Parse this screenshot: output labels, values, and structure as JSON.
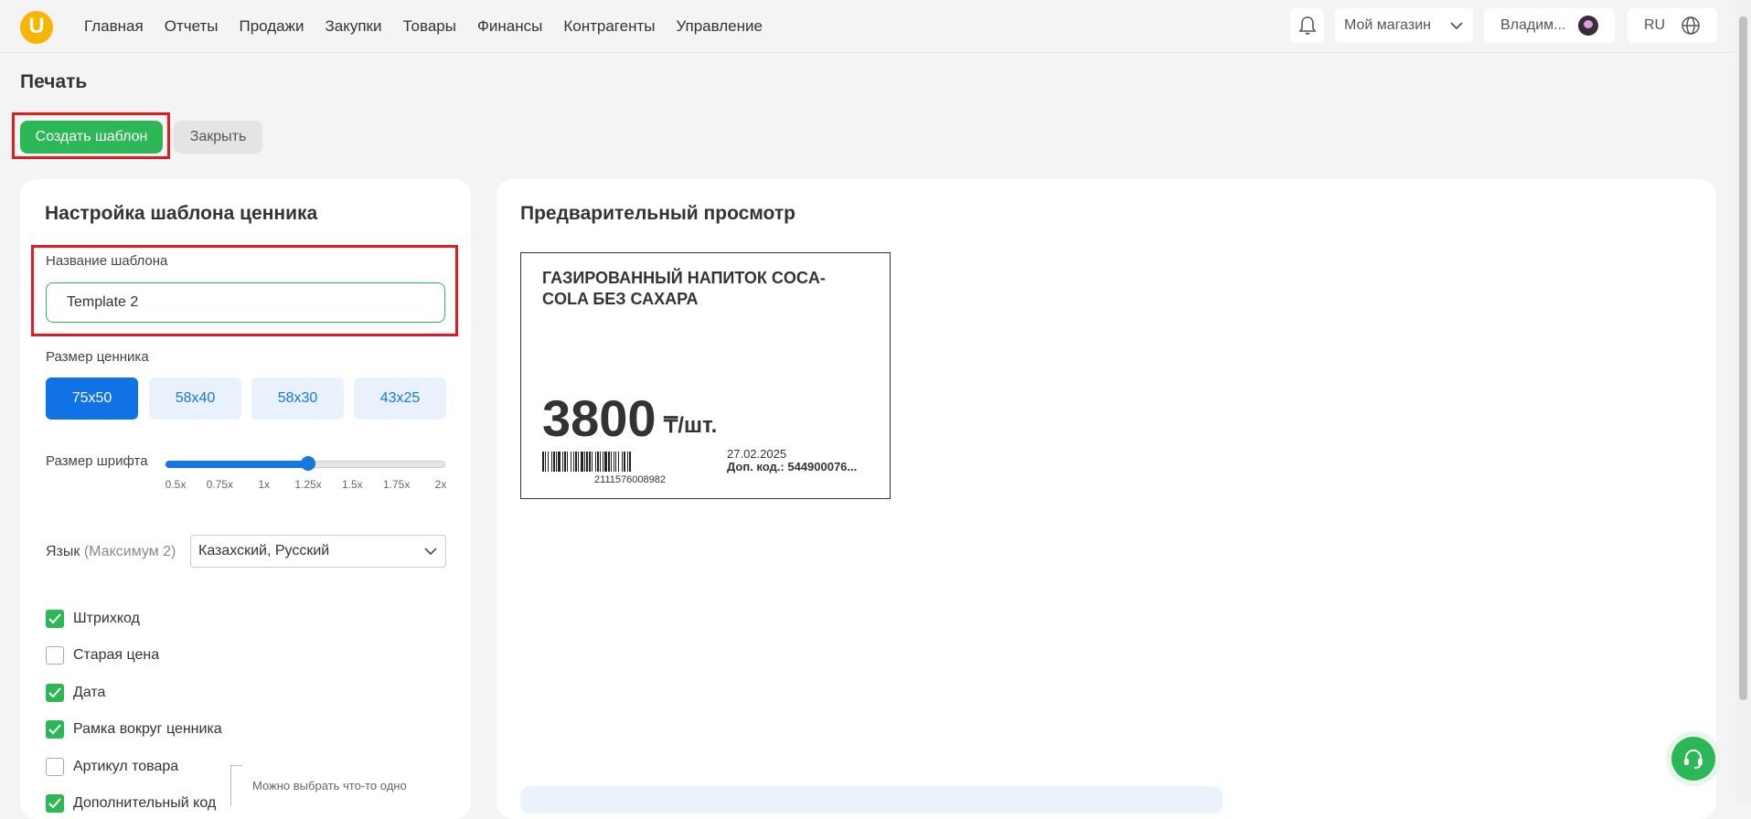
{
  "nav": {
    "logo": "U",
    "items": [
      "Главная",
      "Отчеты",
      "Продажи",
      "Закупки",
      "Товары",
      "Финансы",
      "Контрагенты",
      "Управление"
    ],
    "store": "Мой магазин",
    "user": "Владим...",
    "lang": "RU"
  },
  "page": {
    "title": "Печать",
    "create_btn": "Создать шаблон",
    "close_btn": "Закрыть"
  },
  "settings": {
    "title": "Настройка шаблона ценника",
    "name_label": "Название шаблона",
    "name_value": "Template 2",
    "size_label": "Размер ценника",
    "sizes": [
      "75x50",
      "58x40",
      "58x30",
      "43x25"
    ],
    "active_size": "75x50",
    "font_label": "Размер шрифта",
    "font_ticks": [
      "0.5x",
      "0.75x",
      "1x",
      "1.25x",
      "1.5x",
      "1.75x",
      "2x"
    ],
    "font_value": "1.25x",
    "lang_label": "Язык",
    "lang_hint": "(Максимум 2)",
    "lang_value": "Казахский, Русский",
    "checkboxes": [
      {
        "label": "Штрихкод",
        "checked": true
      },
      {
        "label": "Старая цена",
        "checked": false
      },
      {
        "label": "Дата",
        "checked": true
      },
      {
        "label": "Рамка вокруг ценника",
        "checked": true
      },
      {
        "label": "Артикул товара",
        "checked": false
      },
      {
        "label": "Дополнительный код",
        "checked": true
      }
    ],
    "choose_one_hint": "Можно выбрать что-то одно"
  },
  "preview": {
    "title": "Предварительный просмотр",
    "product_name": "ГАЗИРОВАННЫЙ НАПИТОК COCA-COLA БЕЗ САХАРА",
    "price": "3800",
    "unit": "₸/шт.",
    "barcode_number": "2111576008982",
    "date": "27.02.2025",
    "extra_code": "Доп. код.: 544900076..."
  },
  "colors": {
    "accent_green": "#2db757",
    "accent_blue": "#0f73e6",
    "highlight_red": "#e21b23"
  },
  "icons": [
    "bell-icon",
    "chevron-down-icon",
    "globe-icon",
    "check-icon",
    "headset-icon"
  ]
}
